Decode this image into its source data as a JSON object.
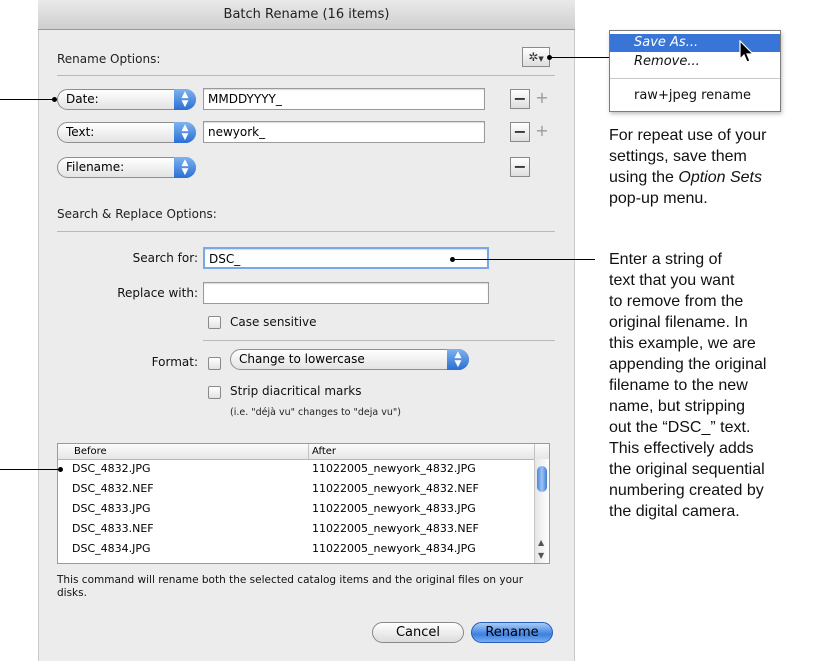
{
  "dialog": {
    "title": "Batch Rename (16 items)",
    "rename_options_label": "Rename Options:",
    "rows": [
      {
        "type": "Date:",
        "value": "MMDDYYYY_"
      },
      {
        "type": "Text:",
        "value": "newyork_"
      },
      {
        "type": "Filename:",
        "value": ""
      }
    ],
    "remove_symbol": "−",
    "add_symbol": "+",
    "gear_symbol": "✲",
    "search_replace_label": "Search & Replace Options:",
    "search_for_label": "Search for:",
    "search_for_value": "DSC_",
    "replace_with_label": "Replace with:",
    "replace_with_value": "",
    "case_sensitive_label": "Case sensitive",
    "format_label": "Format:",
    "format_value": "Change to lowercase",
    "strip_label": "Strip diacritical marks",
    "strip_hint": "(i.e. \"déjà vu\" changes to \"deja vu\")",
    "table": {
      "headers": [
        "Before",
        "After"
      ],
      "rows": [
        [
          "DSC_4832.JPG",
          "11022005_newyork_4832.JPG"
        ],
        [
          "DSC_4832.NEF",
          "11022005_newyork_4832.NEF"
        ],
        [
          "DSC_4833.JPG",
          "11022005_newyork_4833.JPG"
        ],
        [
          "DSC_4833.NEF",
          "11022005_newyork_4833.NEF"
        ],
        [
          "DSC_4834.JPG",
          "11022005_newyork_4834.JPG"
        ]
      ]
    },
    "notice": "This command will rename both the selected catalog items and the original files on your disks.",
    "cancel_label": "Cancel",
    "rename_label": "Rename"
  },
  "menu": {
    "items": [
      "Save As...",
      "Remove...",
      "raw+jpeg rename"
    ]
  },
  "annotations": {
    "option_sets": [
      "For repeat use of your",
      "settings, save them",
      "using the ",
      "Option Sets",
      "pop-up menu."
    ],
    "search": [
      "Enter a string of",
      "text that you want",
      "to remove from the",
      "original filename. In",
      "this example, we are",
      "appending the original",
      "filename to the new",
      "name, but stripping",
      "out the “DSC_” text.",
      "This effectively adds",
      "the original sequential",
      "numbering created by",
      "the digital camera."
    ]
  },
  "colors": {
    "accent_blue": "#3875d7",
    "dialog_bg": "#ececec"
  }
}
